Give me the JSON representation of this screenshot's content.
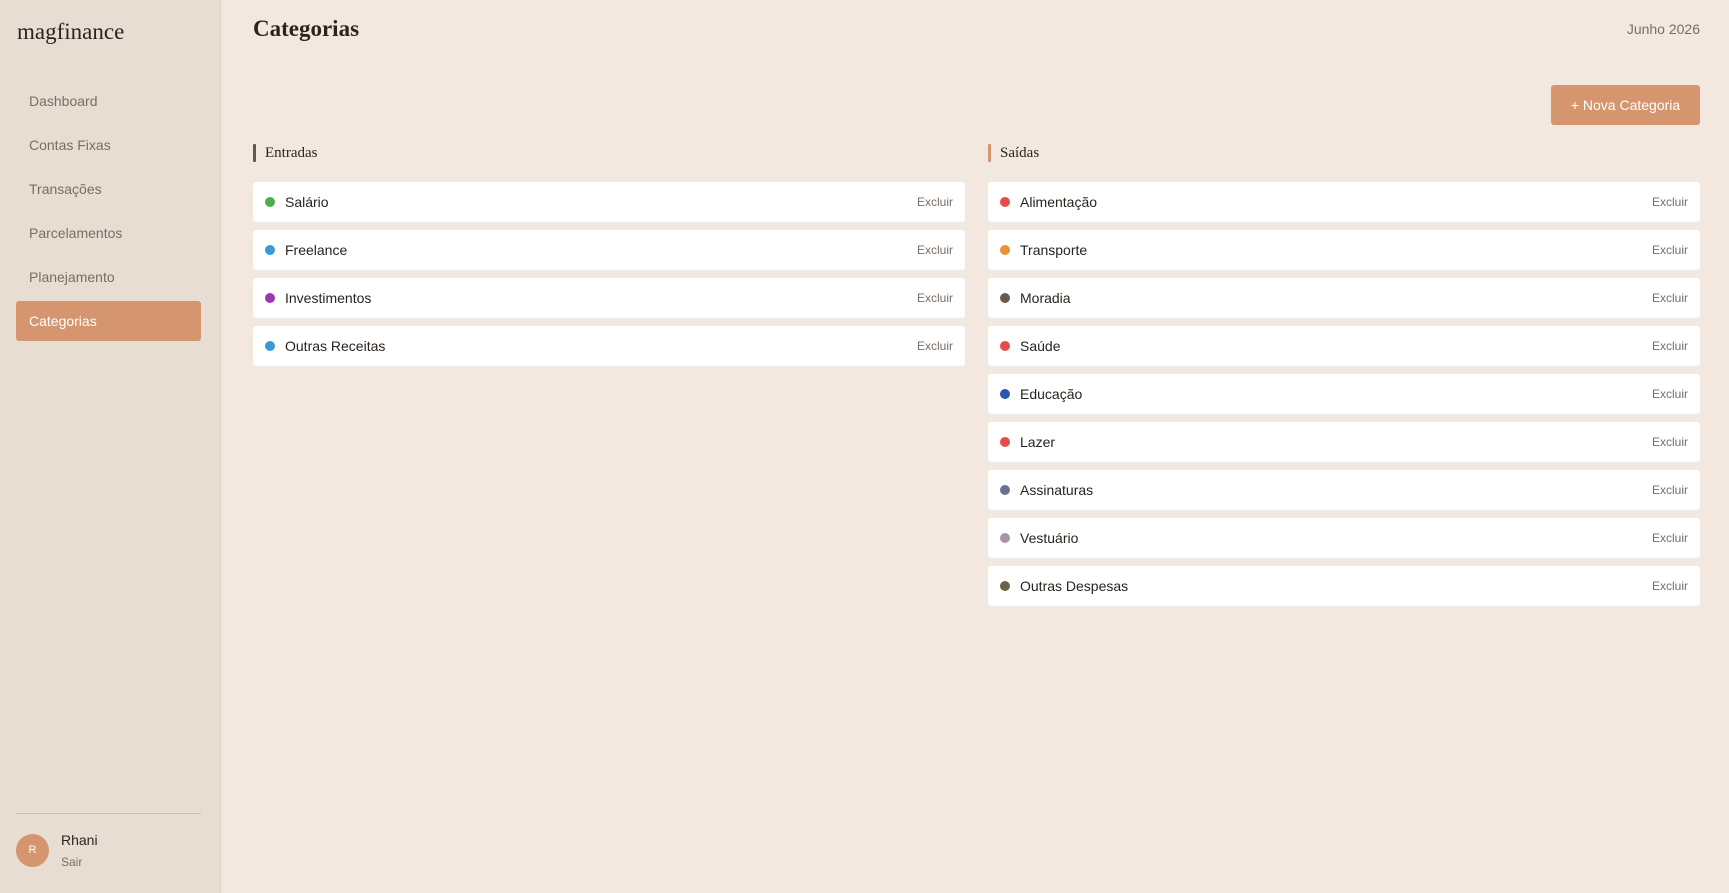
{
  "brand": "magfinance",
  "sidebar": {
    "items": [
      {
        "label": "Dashboard"
      },
      {
        "label": "Contas Fixas"
      },
      {
        "label": "Transações"
      },
      {
        "label": "Parcelamentos"
      },
      {
        "label": "Planejamento"
      },
      {
        "label": "Categorias"
      }
    ],
    "active_index": 5
  },
  "user": {
    "initial": "R",
    "name": "Rhani",
    "logout_label": "Sair"
  },
  "header": {
    "title": "Categorias",
    "month": "Junho 2026"
  },
  "new_button_label": "+ Nova Categoria",
  "delete_label": "Excluir",
  "income": {
    "title": "Entradas",
    "items": [
      {
        "label": "Salário",
        "color": "#4caf50"
      },
      {
        "label": "Freelance",
        "color": "#3a9ad9"
      },
      {
        "label": "Investimentos",
        "color": "#9c36b5"
      },
      {
        "label": "Outras Receitas",
        "color": "#3a9ad9"
      }
    ]
  },
  "expense": {
    "title": "Saídas",
    "items": [
      {
        "label": "Alimentação",
        "color": "#e74c4c"
      },
      {
        "label": "Transporte",
        "color": "#e8923a"
      },
      {
        "label": "Moradia",
        "color": "#6b5a4a"
      },
      {
        "label": "Saúde",
        "color": "#e74c4c"
      },
      {
        "label": "Educação",
        "color": "#2a56b0"
      },
      {
        "label": "Lazer",
        "color": "#e74c4c"
      },
      {
        "label": "Assinaturas",
        "color": "#6b7290"
      },
      {
        "label": "Vestuário",
        "color": "#a993a6"
      },
      {
        "label": "Outras Despesas",
        "color": "#6a6248"
      }
    ]
  },
  "colors": {
    "accent": "#d4956f",
    "background": "#f2e8df",
    "sidebar": "#e8ddd3"
  }
}
